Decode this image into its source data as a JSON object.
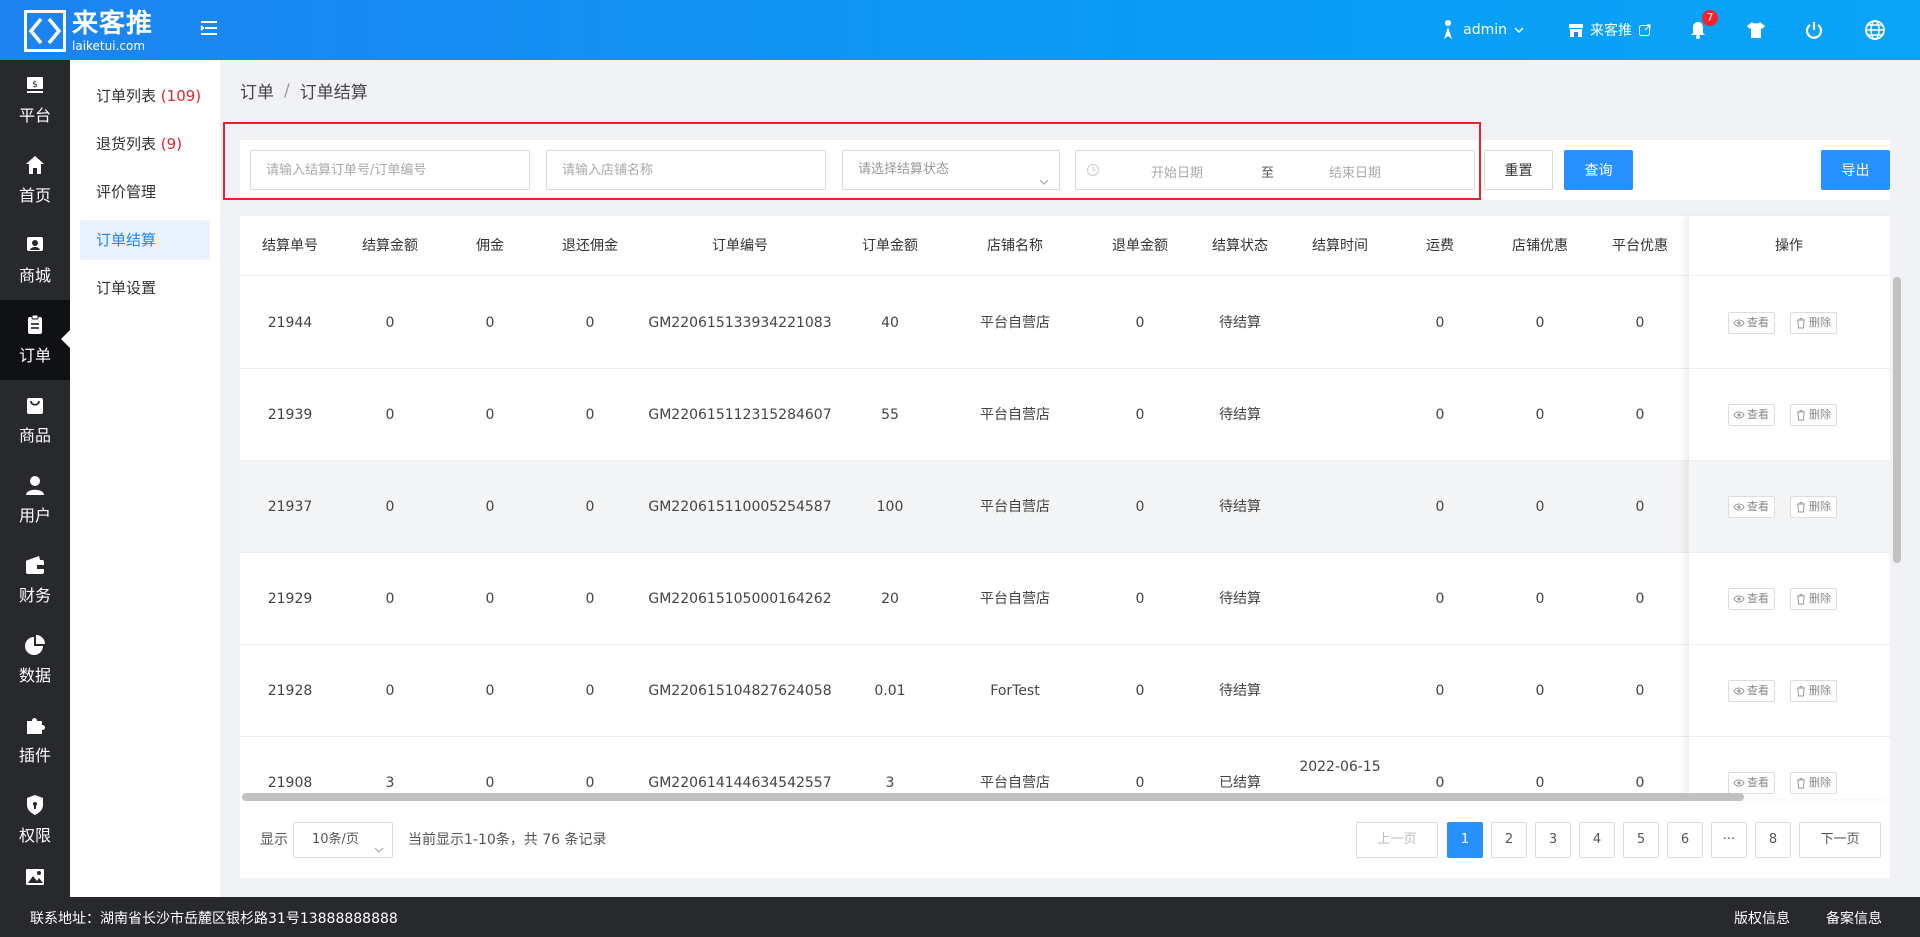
{
  "header": {
    "logo_cn": "来客推",
    "logo_en": "laiketui.com",
    "user": "admin",
    "store": "来客推",
    "notify_count": "7"
  },
  "sidebar": {
    "items": [
      {
        "label": "平台",
        "icon": "platform-icon"
      },
      {
        "label": "首页",
        "icon": "home-icon"
      },
      {
        "label": "商城",
        "icon": "mall-icon"
      },
      {
        "label": "订单",
        "icon": "order-icon"
      },
      {
        "label": "商品",
        "icon": "goods-icon"
      },
      {
        "label": "用户",
        "icon": "user-icon"
      },
      {
        "label": "财务",
        "icon": "wallet-icon"
      },
      {
        "label": "数据",
        "icon": "pie-chart-icon"
      },
      {
        "label": "插件",
        "icon": "puzzle-icon"
      },
      {
        "label": "权限",
        "icon": "shield-icon"
      },
      {
        "label": "",
        "icon": "image-icon"
      }
    ]
  },
  "submenu": {
    "items": [
      {
        "label": "订单列表",
        "count": "(109)"
      },
      {
        "label": "退货列表",
        "count": "(9)"
      },
      {
        "label": "评价管理",
        "count": ""
      },
      {
        "label": "订单结算",
        "count": ""
      },
      {
        "label": "订单设置",
        "count": ""
      }
    ]
  },
  "breadcrumb": {
    "root": "订单",
    "sep": "/",
    "current": "订单结算"
  },
  "filters": {
    "order_no_placeholder": "请输入结算订单号/订单编号",
    "store_placeholder": "请输入店铺名称",
    "status_placeholder": "请选择结算状态",
    "start_date": "开始日期",
    "to": "至",
    "end_date": "结束日期",
    "reset": "重置",
    "query": "查询",
    "export": "导出"
  },
  "table": {
    "columns": [
      "结算单号",
      "结算金额",
      "佣金",
      "退还佣金",
      "订单编号",
      "订单金额",
      "店铺名称",
      "退单金额",
      "结算状态",
      "结算时间",
      "运费",
      "店铺优惠",
      "平台优惠",
      "操作"
    ],
    "view_label": "查看",
    "delete_label": "删除",
    "rows": [
      [
        "21944",
        "0",
        "0",
        "0",
        "GM220615133934221083",
        "40",
        "平台自营店",
        "0",
        "待结算",
        "",
        "0",
        "0",
        "0"
      ],
      [
        "21939",
        "0",
        "0",
        "0",
        "GM220615112315284607",
        "55",
        "平台自营店",
        "0",
        "待结算",
        "",
        "0",
        "0",
        "0"
      ],
      [
        "21937",
        "0",
        "0",
        "0",
        "GM220615110005254587",
        "100",
        "平台自营店",
        "0",
        "待结算",
        "",
        "0",
        "0",
        "0"
      ],
      [
        "21929",
        "0",
        "0",
        "0",
        "GM220615105000164262",
        "20",
        "平台自营店",
        "0",
        "待结算",
        "",
        "0",
        "0",
        "0"
      ],
      [
        "21928",
        "0",
        "0",
        "0",
        "GM220615104827624058",
        "0.01",
        "ForTest",
        "0",
        "待结算",
        "",
        "0",
        "0",
        "0"
      ],
      [
        "21908",
        "3",
        "0",
        "0",
        "GM220614144634542557",
        "3",
        "平台自营店",
        "0",
        "已结算",
        "2022-06-15",
        "0",
        "0",
        "0"
      ]
    ]
  },
  "pagination": {
    "show_label": "显示",
    "page_size": "10条/页",
    "summary": "当前显示1-10条，共 76 条记录",
    "prev": "上一页",
    "next": "下一页",
    "pages": [
      "1",
      "2",
      "3",
      "4",
      "5",
      "6",
      "···",
      "8"
    ]
  },
  "footer": {
    "address": "联系地址：湖南省长沙市岳麓区银杉路31号13888888888",
    "copyright": "版权信息",
    "icp": "备案信息"
  },
  "colors": {
    "primary": "#2890ff",
    "header": "#1d83f0",
    "sidebar": "#27292d",
    "highlight": "#e5242b"
  }
}
